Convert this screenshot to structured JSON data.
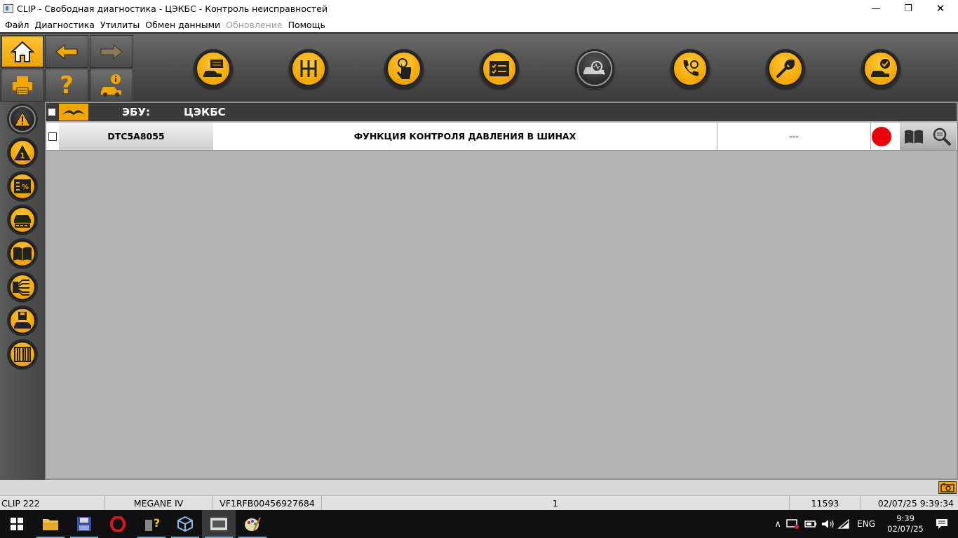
{
  "window": {
    "title": "CLIP - Свободная диагностика - ЦЭКБС - Контроль неисправностей",
    "minimize_glyph": "—",
    "restore_glyph": "❐",
    "close_glyph": "✕"
  },
  "menu": {
    "items": [
      "Файл",
      "Диагностика",
      "Утилиты",
      "Обмен данными",
      "Обновление",
      "Помощь"
    ],
    "disabled": [
      "Обновление"
    ]
  },
  "toolbar": {
    "nav_buttons": [
      {
        "name": "home",
        "icon": "home-icon",
        "active": true
      },
      {
        "name": "back",
        "icon": "arrow-left-icon",
        "active": false
      },
      {
        "name": "forward",
        "icon": "arrow-right-icon",
        "active": false,
        "disabled": true
      },
      {
        "name": "print",
        "icon": "printer-icon",
        "active": false
      },
      {
        "name": "help",
        "icon": "question-icon",
        "active": false
      },
      {
        "name": "vehicle-info",
        "icon": "car-info-icon",
        "active": false
      }
    ],
    "help_glyph": "?",
    "big_buttons": [
      {
        "name": "vehicle-message",
        "icon": "car-message-icon",
        "selected": false
      },
      {
        "name": "gearbox",
        "icon": "gearbox-icon",
        "selected": false
      },
      {
        "name": "touch",
        "icon": "touch-icon",
        "selected": false
      },
      {
        "name": "checklist",
        "icon": "checklist-icon",
        "selected": false
      },
      {
        "name": "diagnostics",
        "icon": "car-diagnostic-icon",
        "selected": true
      },
      {
        "name": "phone-support",
        "icon": "phone-icon",
        "selected": false
      },
      {
        "name": "repair",
        "icon": "wrench-icon",
        "selected": false
      },
      {
        "name": "vehicle-check",
        "icon": "car-check-icon",
        "selected": false
      }
    ]
  },
  "sidebar": {
    "items": [
      {
        "name": "faults-all",
        "icon": "warning-icon",
        "selected": true
      },
      {
        "name": "faults-one",
        "icon": "warning-one-icon",
        "label": "1",
        "selected": false
      },
      {
        "name": "parameters",
        "icon": "percent-list-icon",
        "label": "%",
        "selected": false
      },
      {
        "name": "vehicle-status",
        "icon": "car-status-icon",
        "selected": false
      },
      {
        "name": "documentation",
        "icon": "book-icon",
        "selected": false
      },
      {
        "name": "wiring",
        "icon": "wiring-icon",
        "selected": false
      },
      {
        "name": "save-vehicle",
        "icon": "save-car-icon",
        "selected": false
      },
      {
        "name": "barcode",
        "icon": "barcode-icon",
        "selected": false
      }
    ]
  },
  "ecu": {
    "label": "ЭБУ:",
    "value": "ЦЭКБС"
  },
  "faults": [
    {
      "code": "DTC5A8055",
      "description": "ФУНКЦИЯ КОНТРОЛЯ ДАВЛЕНИЯ В ШИНАХ",
      "status": "---",
      "indicator_color": "#e8000b"
    }
  ],
  "status_bar": {
    "clip_version": "CLIP 222",
    "vehicle": "MEGANE IV",
    "vin": "VF1RFB00456927684",
    "count": "1",
    "code": "11593",
    "datetime": "02/07/25 9:39:34"
  },
  "taskbar": {
    "apps": [
      "windows-start-icon",
      "file-explorer-icon",
      "save-disk-icon",
      "opera-icon",
      "help-tool-icon",
      "virtualbox-icon",
      "clip-app-icon",
      "paint-icon"
    ],
    "active_app": "clip-app-icon",
    "tray_chevron": "∧",
    "language": "ENG",
    "time": "9:39",
    "date": "02/07/25"
  },
  "colors": {
    "accent_orange": "#f3a600",
    "dark_bg": "#3a3a3a",
    "content_bg": "#b4b4b4",
    "fault_red": "#e8000b"
  }
}
